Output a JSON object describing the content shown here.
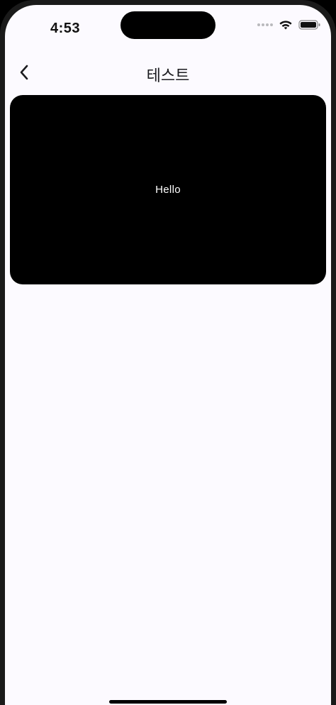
{
  "status_bar": {
    "time": "4:53",
    "icons": [
      "signal-dots-icon",
      "wifi-icon",
      "battery-icon"
    ]
  },
  "nav": {
    "back_icon": "chevron-left-icon",
    "title": "테스트"
  },
  "card": {
    "text": "Hello",
    "background": "#000000"
  },
  "colors": {
    "screen_background": "#fcfaff",
    "text_primary": "#1b1b1f"
  }
}
